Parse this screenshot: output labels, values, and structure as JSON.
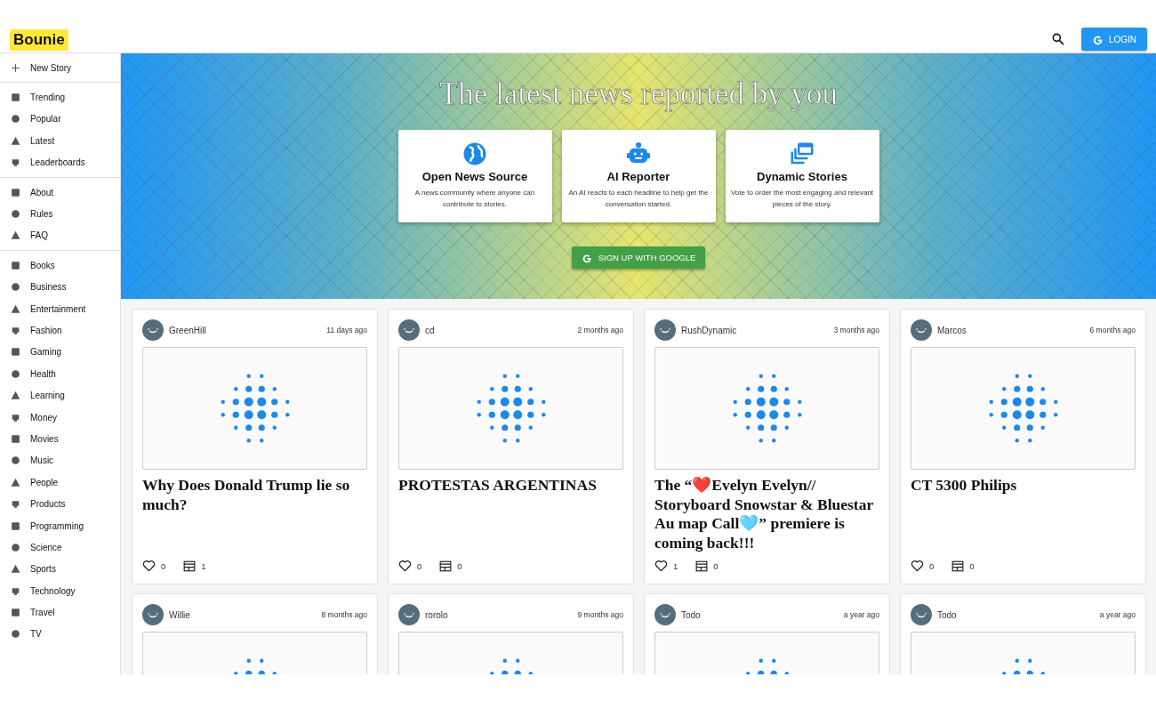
{
  "header": {
    "logo": "Bounie",
    "login": "LOGIN"
  },
  "sidebar": {
    "sections": [
      [
        {
          "label": "New Story"
        }
      ],
      [
        {
          "label": "Trending"
        },
        {
          "label": "Popular"
        },
        {
          "label": "Latest"
        },
        {
          "label": "Leaderboards"
        }
      ],
      [
        {
          "label": "About"
        },
        {
          "label": "Rules"
        },
        {
          "label": "FAQ"
        }
      ],
      [
        {
          "label": "Books"
        },
        {
          "label": "Business"
        },
        {
          "label": "Entertainment"
        },
        {
          "label": "Fashion"
        },
        {
          "label": "Gaming"
        },
        {
          "label": "Health"
        },
        {
          "label": "Learning"
        },
        {
          "label": "Money"
        },
        {
          "label": "Movies"
        },
        {
          "label": "Music"
        },
        {
          "label": "People"
        },
        {
          "label": "Products"
        },
        {
          "label": "Programming"
        },
        {
          "label": "Science"
        },
        {
          "label": "Sports"
        },
        {
          "label": "Technology"
        },
        {
          "label": "Travel"
        },
        {
          "label": "TV"
        }
      ]
    ]
  },
  "hero": {
    "title": "The latest news reported by you",
    "features": [
      {
        "title": "Open News Source",
        "text": "A news community where anyone can contribute to stories."
      },
      {
        "title": "AI Reporter",
        "text": "An AI reacts to each headline to help get the conversation started."
      },
      {
        "title": "Dynamic Stories",
        "text": "Vote to order the most engaging and relevant pieces of the story."
      }
    ],
    "signup": "SIGN UP WITH GOOGLE"
  },
  "stories": [
    {
      "author": "GreenHill",
      "time": "11 days ago",
      "title": "Why Does Donald Trump lie so much?",
      "likes": "0",
      "comments": "1"
    },
    {
      "author": "cd",
      "time": "2 months ago",
      "title": "PROTESTAS ARGENTINAS",
      "likes": "0",
      "comments": "0"
    },
    {
      "author": "RushDynamic",
      "time": "3 months ago",
      "title": "The “❤️Evelyn Evelyn// Storyboard Snowstar & Bluestar Au map Call🩵” premiere is coming back!!!",
      "likes": "1",
      "comments": "0"
    },
    {
      "author": "Marcos",
      "time": "6 months ago",
      "title": "CT 5300 Philips",
      "likes": "0",
      "comments": "0"
    },
    {
      "author": "Willie",
      "time": "8 months ago"
    },
    {
      "author": "rorolo",
      "time": "9 months ago"
    },
    {
      "author": "Todo",
      "time": "a year ago"
    },
    {
      "author": "Todo",
      "time": "a year ago"
    }
  ]
}
